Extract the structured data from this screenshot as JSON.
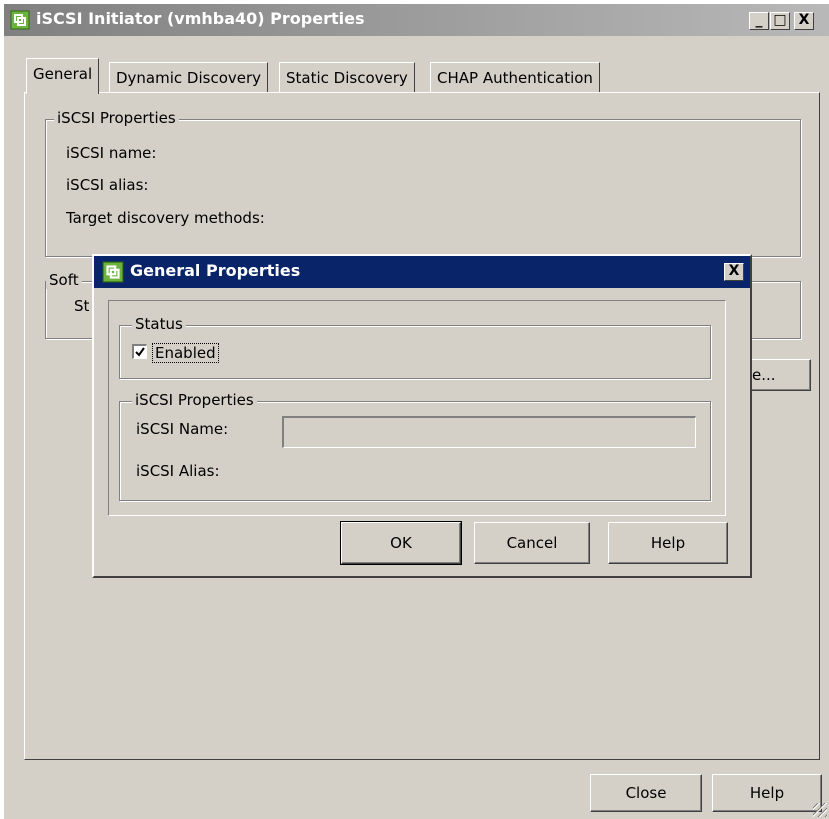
{
  "window": {
    "title": "iSCSI Initiator (vmhba40) Properties",
    "controls": {
      "minimize": "_",
      "maximize": "□",
      "close": "X"
    },
    "tabs": [
      {
        "label": "General",
        "active": true
      },
      {
        "label": "Dynamic Discovery",
        "active": false
      },
      {
        "label": "Static Discovery",
        "active": false
      },
      {
        "label": "CHAP Authentication",
        "active": false
      }
    ],
    "iscsi_properties": {
      "group_label": "iSCSI Properties",
      "name_label": "iSCSI name:",
      "alias_label": "iSCSI alias:",
      "discovery_label": "Target discovery methods:"
    },
    "software_group": {
      "label_partial": "Soft",
      "status_partial": "St",
      "configure_button_partial": "e..."
    },
    "buttons": {
      "close": "Close",
      "help": "Help"
    }
  },
  "dialog": {
    "title": "General Properties",
    "close": "X",
    "status_group": {
      "label": "Status",
      "enabled_label": "Enabled",
      "enabled_checked": true
    },
    "iscsi_group": {
      "label": "iSCSI Properties",
      "name_label": "iSCSI Name:",
      "name_value": "",
      "alias_label": "iSCSI Alias:"
    },
    "buttons": {
      "ok": "OK",
      "cancel": "Cancel",
      "help": "Help"
    }
  },
  "colors": {
    "dialog_face": "#d4d0c8",
    "active_title": "#0a246a",
    "inactive_title": "#808080",
    "vmware_icon": "#6bb33c"
  },
  "icons": {
    "app": "vmware-icon",
    "check": "checkmark-icon"
  }
}
